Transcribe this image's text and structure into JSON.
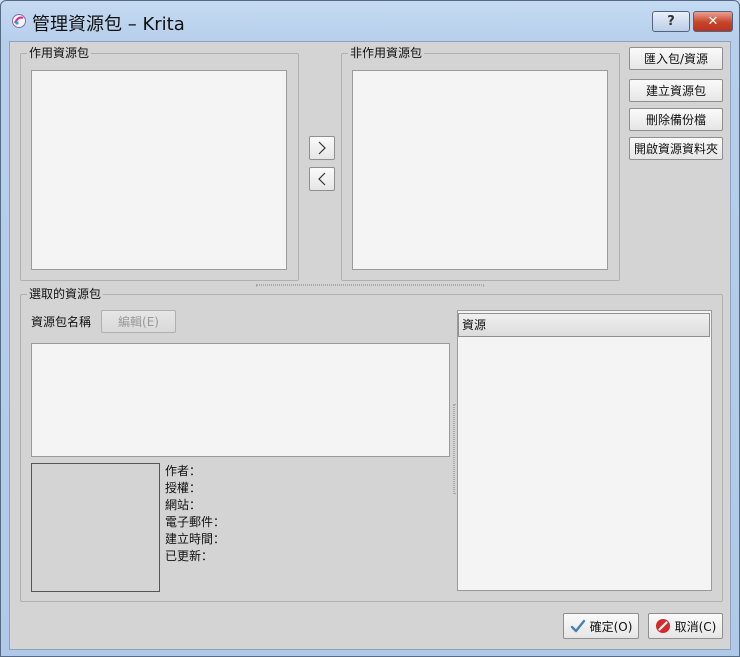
{
  "window": {
    "title": "管理資源包 – Krita",
    "help_label": "?",
    "close_label": "✕"
  },
  "active_group": {
    "title": "作用資源包"
  },
  "inactive_group": {
    "title": "非作用資源包"
  },
  "transfer": {
    "activate_label": ">",
    "deactivate_label": "<"
  },
  "side_buttons": [
    {
      "label": "匯入包/資源"
    },
    {
      "label": "建立資源包"
    },
    {
      "label": "刪除備份檔"
    },
    {
      "label": "開啟資源資料夾"
    }
  ],
  "selected_group": {
    "title": "選取的資源包",
    "name_label": "資源包名稱",
    "edit_label": "編輯(E)",
    "meta": {
      "author": "作者：",
      "license": "授權：",
      "website": "網站：",
      "email": "電子郵件：",
      "created": "建立時間：",
      "updated": "已更新："
    },
    "resources_header": "資源"
  },
  "footer": {
    "ok_label": "確定(O)",
    "cancel_label": "取消(C)"
  }
}
